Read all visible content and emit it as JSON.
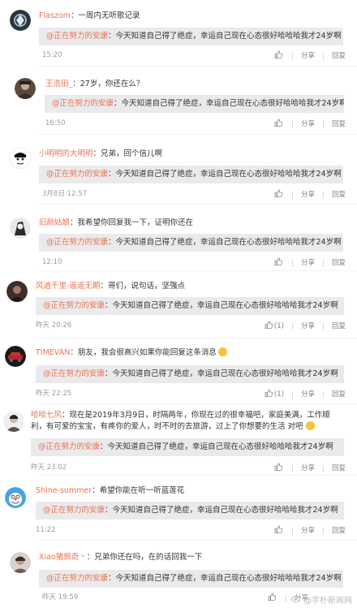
{
  "quote": {
    "link": "@正在努力的安康",
    "text": "：今天知道自己得了绝症，幸运自己现在心态很好哈哈哈我才24岁啊"
  },
  "actions": {
    "share": "分享",
    "reply": "回复"
  },
  "comments": [
    {
      "user": "Flaszom",
      "text": "：一周内无听歌记录",
      "time": "15:20",
      "likes": ""
    },
    {
      "user": "王浩田_",
      "text": "：27岁，你还在么？",
      "time": "16:50",
      "likes": ""
    },
    {
      "user": "小明明的大明明",
      "text": "：兄弟，回个信儿啊",
      "time": "3月8日 12:57",
      "likes": ""
    },
    {
      "user": "旧颜姑娘",
      "text": "：我希望你回复我一下，证明你还在",
      "time": "12:10",
      "likes": ""
    },
    {
      "user": "风逍千里-遥遥无期",
      "text": "：哥们，说句话，坚强点",
      "time": "昨天 20:26",
      "likes": "(1)"
    },
    {
      "user": "TIMEVAN",
      "text": "：朋友，我会很高兴如果你能回复这条消息",
      "time": "昨天 22:25",
      "likes": "(1)"
    },
    {
      "user": "哈哈七风",
      "text": "：现在是2019年3月9日，时隔两年，你现在过的很幸福吧，家庭美满，工作顺利，有可爱的宝宝，有疼你的爱人，时不时的去旅游，过上了你想要的生活 对吧",
      "time": "昨天 23:02",
      "likes": ""
    },
    {
      "user": "Shine-summer",
      "text": "：希望你能在听一听蓝莲花",
      "time": "11:22",
      "likes": ""
    },
    {
      "user": "Xiao猪佩奇丶",
      "text": "：兄弟你还在吗，在的话回我一下",
      "time": "昨天 19:59",
      "likes": ""
    }
  ],
  "watermark": "@芋朴新闻网"
}
